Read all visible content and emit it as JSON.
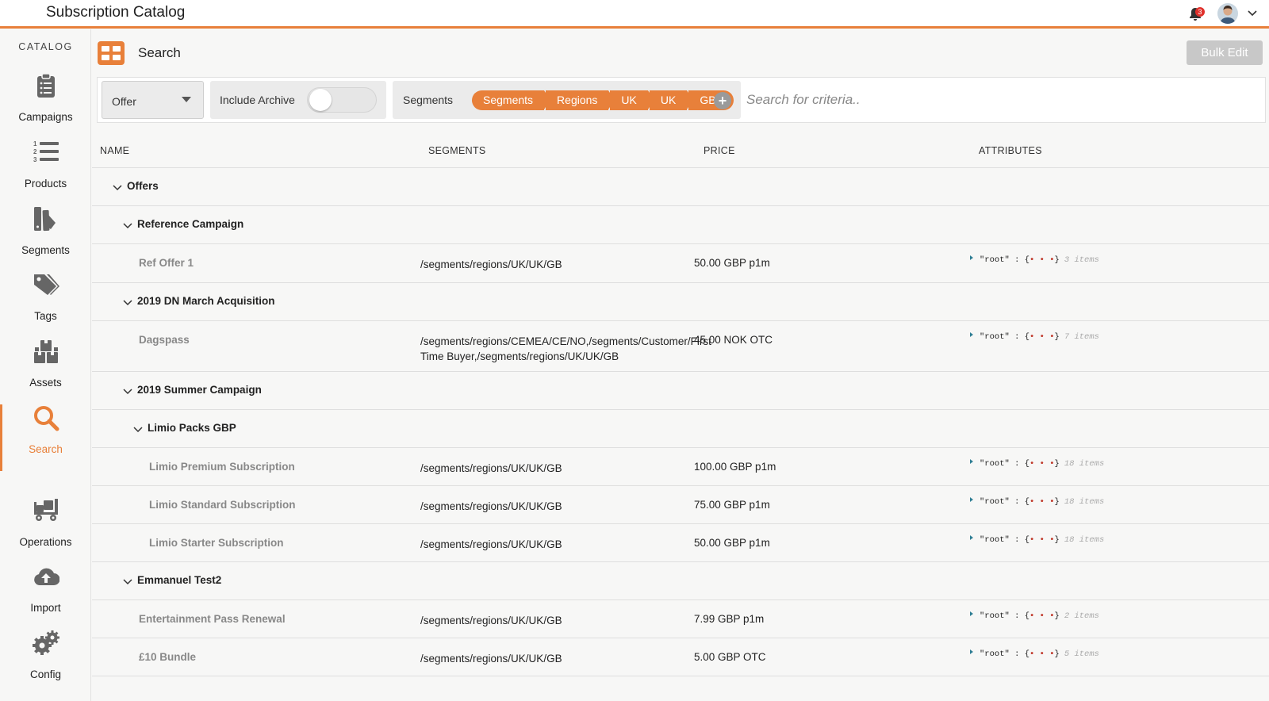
{
  "app": {
    "title": "Subscription Catalog",
    "notification_count": "3"
  },
  "sidebar": {
    "heading": "CATALOG",
    "items": [
      {
        "label": "Campaigns",
        "icon": "clipboard-icon"
      },
      {
        "label": "Products",
        "icon": "numbered-list-icon"
      },
      {
        "label": "Segments",
        "icon": "segments-icon"
      },
      {
        "label": "Tags",
        "icon": "tags-icon"
      },
      {
        "label": "Assets",
        "icon": "boxes-icon"
      },
      {
        "label": "Search",
        "icon": "search-icon",
        "active": true
      },
      {
        "label": "Operations",
        "icon": "dolly-icon"
      },
      {
        "label": "Import",
        "icon": "cloud-upload-icon"
      },
      {
        "label": "Config",
        "icon": "gears-icon"
      }
    ]
  },
  "page": {
    "title": "Search",
    "bulk_edit_label": "Bulk Edit"
  },
  "filters": {
    "type_value": "Offer",
    "archive_label": "Include Archive",
    "archive_on": false,
    "segments_label": "Segments",
    "crumbs": [
      "Segments",
      "Regions",
      "UK",
      "UK",
      "GB"
    ],
    "add_segment": "+",
    "search_placeholder": "Search for criteria.."
  },
  "table": {
    "columns": [
      "NAME",
      "SEGMENTS",
      "PRICE",
      "ATTRIBUTES"
    ],
    "groups": {
      "offers": "Offers",
      "ref_campaign": "Reference Campaign",
      "dn_march": "2019 DN March Acquisition",
      "summer": "2019 Summer Campaign",
      "limio_packs": "Limio Packs GBP",
      "emmanuel": "Emmanuel Test2"
    },
    "rows": [
      {
        "name": "Ref Offer 1",
        "segments": "/segments/regions/UK/UK/GB",
        "price": "50.00 GBP p1m",
        "attr_key": "\"root\" : {",
        "attr_dots": "• • •",
        "attr_close": "}",
        "attr_count": "3 items"
      },
      {
        "name": "Dagspass",
        "segments": "/segments/regions/CEMEA/CE/NO,/segments/Customer/First Time Buyer,/segments/regions/UK/UK/GB",
        "price": "45.00 NOK OTC",
        "attr_key": "\"root\" : {",
        "attr_dots": "• • •",
        "attr_close": "}",
        "attr_count": "7 items"
      },
      {
        "name": "Limio Premium Subscription",
        "segments": "/segments/regions/UK/UK/GB",
        "price": "100.00 GBP p1m",
        "attr_key": "\"root\" : {",
        "attr_dots": "• • •",
        "attr_close": "}",
        "attr_count": "18 items"
      },
      {
        "name": "Limio Standard Subscription",
        "segments": "/segments/regions/UK/UK/GB",
        "price": "75.00 GBP p1m",
        "attr_key": "\"root\" : {",
        "attr_dots": "• • •",
        "attr_close": "}",
        "attr_count": "18 items"
      },
      {
        "name": "Limio Starter Subscription",
        "segments": "/segments/regions/UK/UK/GB",
        "price": "50.00 GBP p1m",
        "attr_key": "\"root\" : {",
        "attr_dots": "• • •",
        "attr_close": "}",
        "attr_count": "18 items"
      },
      {
        "name": "Entertainment Pass Renewal",
        "segments": "/segments/regions/UK/UK/GB",
        "price": "7.99 GBP p1m",
        "attr_key": "\"root\" : {",
        "attr_dots": "• • •",
        "attr_close": "}",
        "attr_count": "2 items"
      },
      {
        "name": "£10 Bundle",
        "segments": "/segments/regions/UK/UK/GB",
        "price": "5.00 GBP OTC",
        "attr_key": "\"root\" : {",
        "attr_dots": "• • •",
        "attr_close": "}",
        "attr_count": "5 items"
      }
    ]
  },
  "colors": {
    "accent": "#e8803a",
    "muted_text": "#888888",
    "attr_caret": "#2f7e94",
    "attr_dots": "#c0392b"
  }
}
